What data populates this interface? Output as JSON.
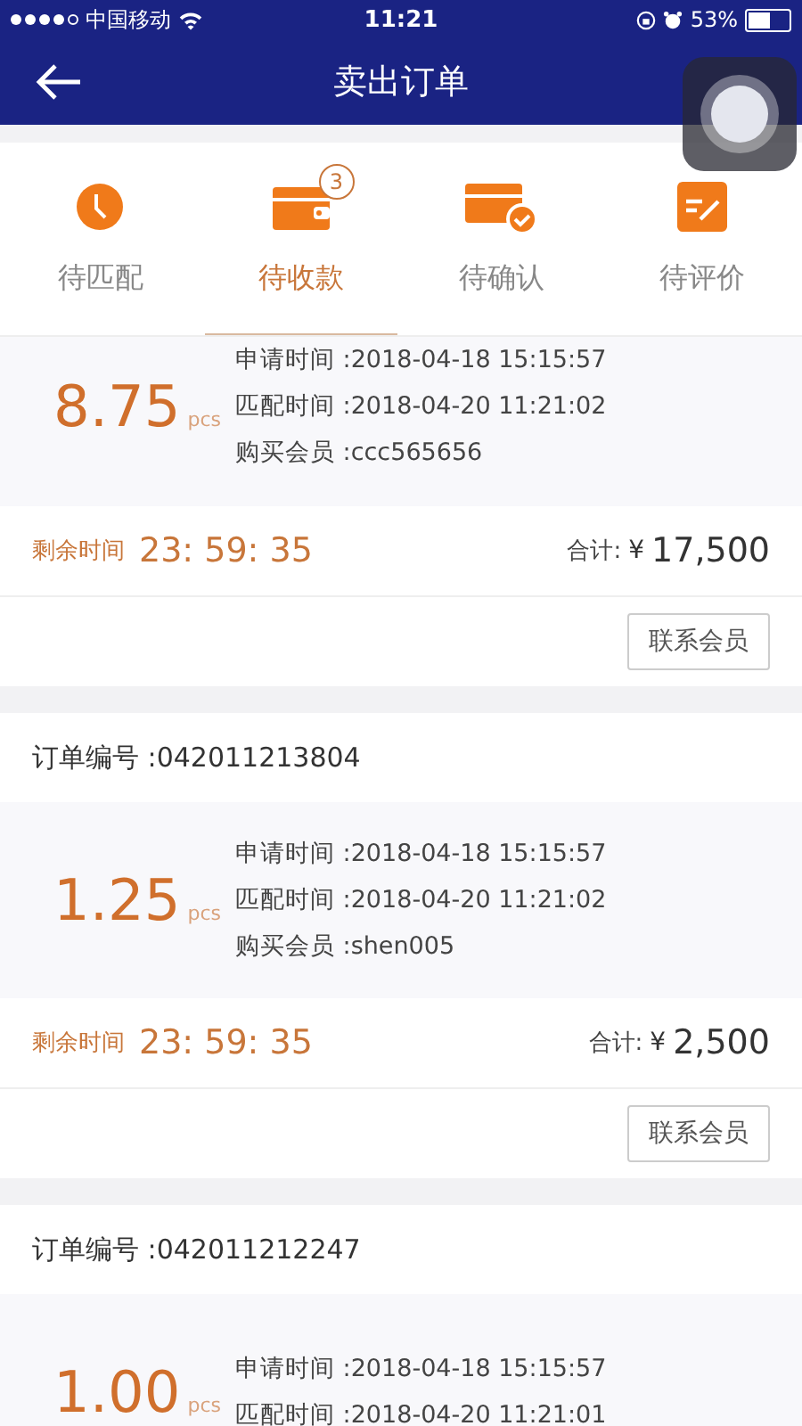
{
  "status_bar": {
    "carrier": "中国移动",
    "time": "11:21",
    "battery": "53%"
  },
  "nav": {
    "title": "卖出订单"
  },
  "tabs": [
    {
      "label": "待匹配",
      "kind": "clock",
      "selected": false
    },
    {
      "label": "待收款",
      "kind": "wallet",
      "badge": "3",
      "selected": true
    },
    {
      "label": "待确认",
      "kind": "card",
      "selected": false
    },
    {
      "label": "待评价",
      "kind": "review",
      "selected": false
    }
  ],
  "orders": [
    {
      "quantity": "8.75",
      "unit": "pcs",
      "details": [
        "申请时间 :2018-04-18 15:15:57",
        "匹配时间 :2018-04-20 11:21:02",
        "购买会员 :ccc565656"
      ],
      "remaining_label": "剩余时间",
      "remaining": "23: 59: 35",
      "total_label": "合计:",
      "currency": "¥",
      "total": "17,500",
      "button": "联系会员"
    },
    {
      "order_no": "订单编号 :042011213804",
      "quantity": "1.25",
      "unit": "pcs",
      "details": [
        "申请时间 :2018-04-18 15:15:57",
        "匹配时间 :2018-04-20 11:21:02",
        "购买会员 :shen005"
      ],
      "remaining_label": "剩余时间",
      "remaining": "23: 59: 35",
      "total_label": "合计:",
      "currency": "¥",
      "total": "2,500",
      "button": "联系会员"
    },
    {
      "order_no": "订单编号 :042011212247",
      "quantity": "1.00",
      "unit": "pcs",
      "details": [
        "申请时间 :2018-04-18 15:15:57",
        "匹配时间 :2018-04-20 11:21:01"
      ]
    }
  ]
}
